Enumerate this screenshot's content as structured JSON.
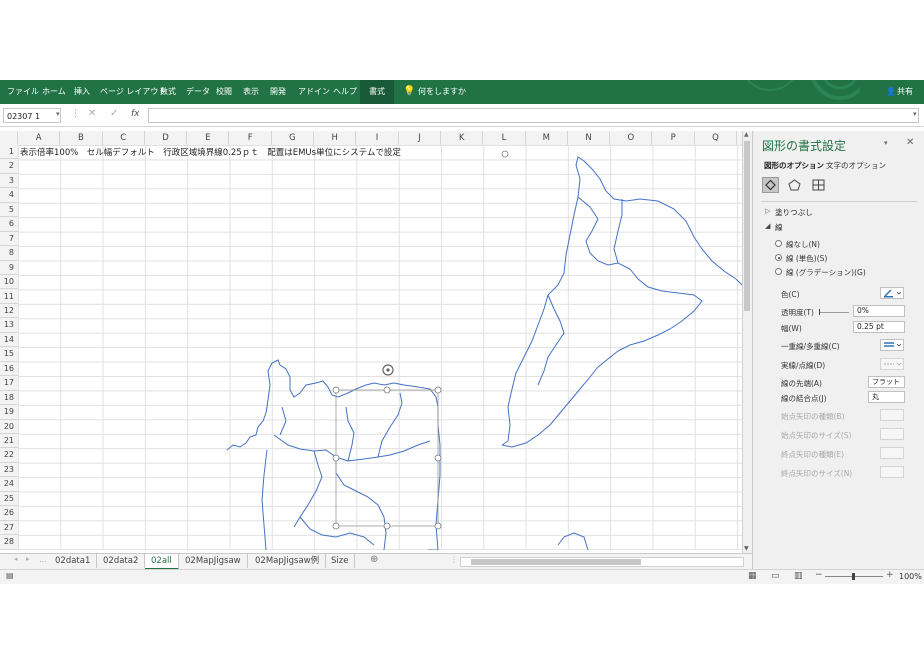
{
  "ribbon": {
    "tabs": [
      "ファイル",
      "ホーム",
      "挿入",
      "ページ レイアウト",
      "数式",
      "データ",
      "校閲",
      "表示",
      "開発",
      "アドイン",
      "ヘルプ"
    ],
    "active_tab": "書式",
    "tell_me": "何をしますか",
    "share": "共有",
    "color": "#217346"
  },
  "formula_bar": {
    "name_box": "02307 1",
    "fx": "fx",
    "value": ""
  },
  "grid": {
    "columns": [
      "A",
      "B",
      "C",
      "D",
      "E",
      "F",
      "G",
      "H",
      "I",
      "J",
      "K",
      "L",
      "M",
      "N",
      "O",
      "P",
      "Q"
    ],
    "rows": [
      "1",
      "2",
      "3",
      "4",
      "5",
      "6",
      "7",
      "8",
      "9",
      "10",
      "11",
      "12",
      "13",
      "14",
      "15",
      "16",
      "17",
      "18",
      "19",
      "20",
      "21",
      "22",
      "23",
      "24",
      "25",
      "26",
      "27",
      "28"
    ],
    "a1_text": "表示倍率100%　セル幅デフォルト　行政区域境界線0.25ｐｔ　配置はEMUs単位にシステムで設定"
  },
  "sheets": {
    "tabs": [
      "02data1",
      "02data2",
      "02all",
      "02MapJigsaw",
      "02MapJigsaw例",
      "Size"
    ],
    "active": "02all"
  },
  "status": {
    "zoom": "100%"
  },
  "pane": {
    "title": "図形の書式設定",
    "tab_shape": "図形のオプション",
    "tab_text": "文字のオプション",
    "fill_section": "塗りつぶし",
    "line_section": "線",
    "radio_none": "線なし(N)",
    "radio_solid": "線 (単色)(S)",
    "radio_gradient": "線 (グラデーション)(G)",
    "color_label": "色(C)",
    "transparency_label": "透明度(T)",
    "transparency_value": "0%",
    "width_label": "幅(W)",
    "width_value": "0.25 pt",
    "compound_label": "一重線/多重線(C)",
    "dash_label": "実線/点線(D)",
    "cap_label": "線の先端(A)",
    "cap_value": "フラット",
    "join_label": "線の結合点(J)",
    "join_value": "丸",
    "begin_arrow_type": "始点矢印の種類(B)",
    "begin_arrow_size": "始点矢印のサイズ(S)",
    "end_arrow_type": "終点矢印の種類(E)",
    "end_arrow_size": "終点矢印のサイズ(N)"
  },
  "map_color": "#4472c4"
}
